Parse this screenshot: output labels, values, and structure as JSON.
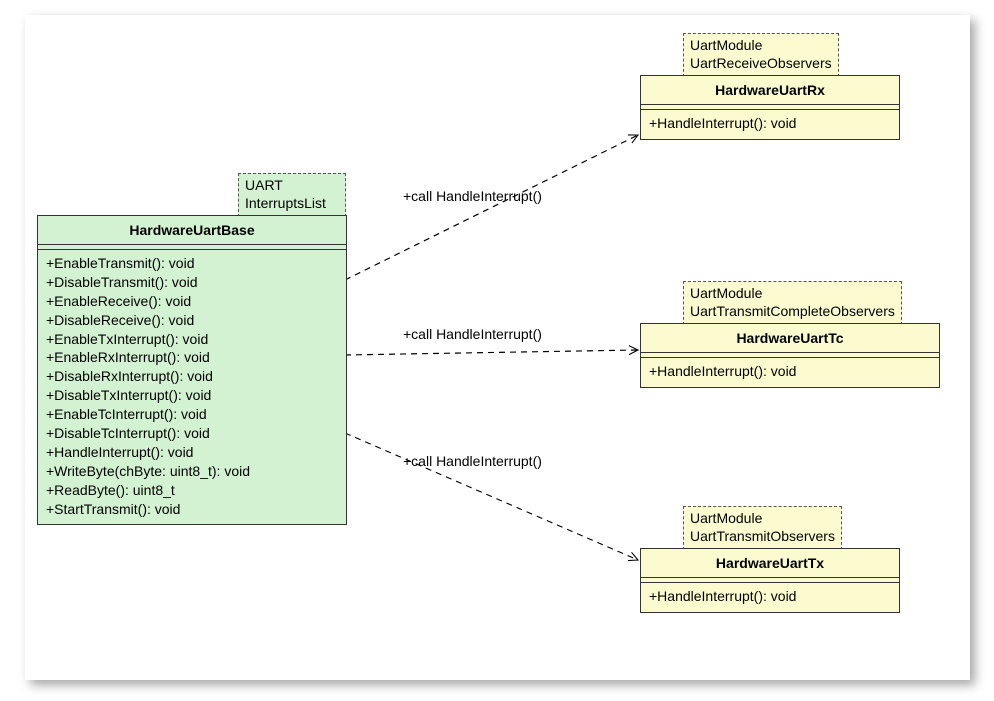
{
  "base": {
    "name": "HardwareUartBase",
    "template": "UART\nInterruptsList",
    "methods": [
      "+EnableTransmit(): void",
      "+DisableTransmit(): void",
      "+EnableReceive(): void",
      "+DisableReceive(): void",
      "+EnableTxInterrupt(): void",
      "+EnableRxInterrupt(): void",
      "+DisableRxInterrupt(): void",
      "+DisableTxInterrupt(): void",
      "+EnableTcInterrupt(): void",
      "+DisableTcInterrupt(): void",
      "+HandleInterrupt(): void",
      "+WriteByte(chByte: uint8_t): void",
      "+ReadByte(): uint8_t",
      "+StartTransmit(): void"
    ]
  },
  "rx": {
    "name": "HardwareUartRx",
    "template": "UartModule\nUartReceiveObservers",
    "methods": [
      "+HandleInterrupt(): void"
    ]
  },
  "tc": {
    "name": "HardwareUartTc",
    "template": "UartModule\nUartTransmitCompleteObservers",
    "methods": [
      "+HandleInterrupt(): void"
    ]
  },
  "tx": {
    "name": "HardwareUartTx",
    "template": "UartModule\nUartTransmitObservers",
    "methods": [
      "+HandleInterrupt(): void"
    ]
  },
  "labels": {
    "toRx": "+call HandleInterrupt()",
    "toTc": "+call HandleInterrupt()",
    "toTx": "+call HandleInterrupt()"
  }
}
